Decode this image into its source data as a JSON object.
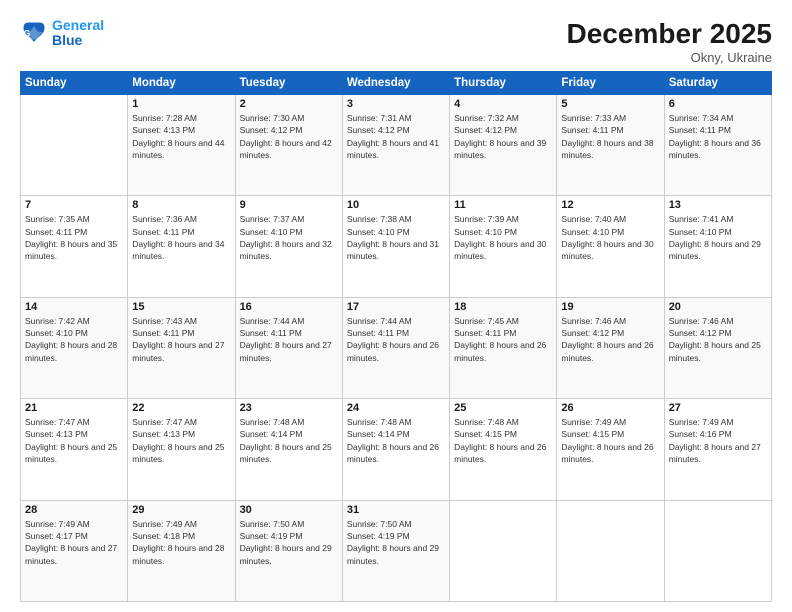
{
  "header": {
    "logo_line1": "General",
    "logo_line2": "Blue",
    "month_title": "December 2025",
    "location": "Okny, Ukraine"
  },
  "days_of_week": [
    "Sunday",
    "Monday",
    "Tuesday",
    "Wednesday",
    "Thursday",
    "Friday",
    "Saturday"
  ],
  "weeks": [
    [
      {
        "day": "",
        "sunrise": "",
        "sunset": "",
        "daylight": ""
      },
      {
        "day": "1",
        "sunrise": "Sunrise: 7:28 AM",
        "sunset": "Sunset: 4:13 PM",
        "daylight": "Daylight: 8 hours and 44 minutes."
      },
      {
        "day": "2",
        "sunrise": "Sunrise: 7:30 AM",
        "sunset": "Sunset: 4:12 PM",
        "daylight": "Daylight: 8 hours and 42 minutes."
      },
      {
        "day": "3",
        "sunrise": "Sunrise: 7:31 AM",
        "sunset": "Sunset: 4:12 PM",
        "daylight": "Daylight: 8 hours and 41 minutes."
      },
      {
        "day": "4",
        "sunrise": "Sunrise: 7:32 AM",
        "sunset": "Sunset: 4:12 PM",
        "daylight": "Daylight: 8 hours and 39 minutes."
      },
      {
        "day": "5",
        "sunrise": "Sunrise: 7:33 AM",
        "sunset": "Sunset: 4:11 PM",
        "daylight": "Daylight: 8 hours and 38 minutes."
      },
      {
        "day": "6",
        "sunrise": "Sunrise: 7:34 AM",
        "sunset": "Sunset: 4:11 PM",
        "daylight": "Daylight: 8 hours and 36 minutes."
      }
    ],
    [
      {
        "day": "7",
        "sunrise": "Sunrise: 7:35 AM",
        "sunset": "Sunset: 4:11 PM",
        "daylight": "Daylight: 8 hours and 35 minutes."
      },
      {
        "day": "8",
        "sunrise": "Sunrise: 7:36 AM",
        "sunset": "Sunset: 4:11 PM",
        "daylight": "Daylight: 8 hours and 34 minutes."
      },
      {
        "day": "9",
        "sunrise": "Sunrise: 7:37 AM",
        "sunset": "Sunset: 4:10 PM",
        "daylight": "Daylight: 8 hours and 32 minutes."
      },
      {
        "day": "10",
        "sunrise": "Sunrise: 7:38 AM",
        "sunset": "Sunset: 4:10 PM",
        "daylight": "Daylight: 8 hours and 31 minutes."
      },
      {
        "day": "11",
        "sunrise": "Sunrise: 7:39 AM",
        "sunset": "Sunset: 4:10 PM",
        "daylight": "Daylight: 8 hours and 30 minutes."
      },
      {
        "day": "12",
        "sunrise": "Sunrise: 7:40 AM",
        "sunset": "Sunset: 4:10 PM",
        "daylight": "Daylight: 8 hours and 30 minutes."
      },
      {
        "day": "13",
        "sunrise": "Sunrise: 7:41 AM",
        "sunset": "Sunset: 4:10 PM",
        "daylight": "Daylight: 8 hours and 29 minutes."
      }
    ],
    [
      {
        "day": "14",
        "sunrise": "Sunrise: 7:42 AM",
        "sunset": "Sunset: 4:10 PM",
        "daylight": "Daylight: 8 hours and 28 minutes."
      },
      {
        "day": "15",
        "sunrise": "Sunrise: 7:43 AM",
        "sunset": "Sunset: 4:11 PM",
        "daylight": "Daylight: 8 hours and 27 minutes."
      },
      {
        "day": "16",
        "sunrise": "Sunrise: 7:44 AM",
        "sunset": "Sunset: 4:11 PM",
        "daylight": "Daylight: 8 hours and 27 minutes."
      },
      {
        "day": "17",
        "sunrise": "Sunrise: 7:44 AM",
        "sunset": "Sunset: 4:11 PM",
        "daylight": "Daylight: 8 hours and 26 minutes."
      },
      {
        "day": "18",
        "sunrise": "Sunrise: 7:45 AM",
        "sunset": "Sunset: 4:11 PM",
        "daylight": "Daylight: 8 hours and 26 minutes."
      },
      {
        "day": "19",
        "sunrise": "Sunrise: 7:46 AM",
        "sunset": "Sunset: 4:12 PM",
        "daylight": "Daylight: 8 hours and 26 minutes."
      },
      {
        "day": "20",
        "sunrise": "Sunrise: 7:46 AM",
        "sunset": "Sunset: 4:12 PM",
        "daylight": "Daylight: 8 hours and 25 minutes."
      }
    ],
    [
      {
        "day": "21",
        "sunrise": "Sunrise: 7:47 AM",
        "sunset": "Sunset: 4:13 PM",
        "daylight": "Daylight: 8 hours and 25 minutes."
      },
      {
        "day": "22",
        "sunrise": "Sunrise: 7:47 AM",
        "sunset": "Sunset: 4:13 PM",
        "daylight": "Daylight: 8 hours and 25 minutes."
      },
      {
        "day": "23",
        "sunrise": "Sunrise: 7:48 AM",
        "sunset": "Sunset: 4:14 PM",
        "daylight": "Daylight: 8 hours and 25 minutes."
      },
      {
        "day": "24",
        "sunrise": "Sunrise: 7:48 AM",
        "sunset": "Sunset: 4:14 PM",
        "daylight": "Daylight: 8 hours and 26 minutes."
      },
      {
        "day": "25",
        "sunrise": "Sunrise: 7:48 AM",
        "sunset": "Sunset: 4:15 PM",
        "daylight": "Daylight: 8 hours and 26 minutes."
      },
      {
        "day": "26",
        "sunrise": "Sunrise: 7:49 AM",
        "sunset": "Sunset: 4:15 PM",
        "daylight": "Daylight: 8 hours and 26 minutes."
      },
      {
        "day": "27",
        "sunrise": "Sunrise: 7:49 AM",
        "sunset": "Sunset: 4:16 PM",
        "daylight": "Daylight: 8 hours and 27 minutes."
      }
    ],
    [
      {
        "day": "28",
        "sunrise": "Sunrise: 7:49 AM",
        "sunset": "Sunset: 4:17 PM",
        "daylight": "Daylight: 8 hours and 27 minutes."
      },
      {
        "day": "29",
        "sunrise": "Sunrise: 7:49 AM",
        "sunset": "Sunset: 4:18 PM",
        "daylight": "Daylight: 8 hours and 28 minutes."
      },
      {
        "day": "30",
        "sunrise": "Sunrise: 7:50 AM",
        "sunset": "Sunset: 4:19 PM",
        "daylight": "Daylight: 8 hours and 29 minutes."
      },
      {
        "day": "31",
        "sunrise": "Sunrise: 7:50 AM",
        "sunset": "Sunset: 4:19 PM",
        "daylight": "Daylight: 8 hours and 29 minutes."
      },
      {
        "day": "",
        "sunrise": "",
        "sunset": "",
        "daylight": ""
      },
      {
        "day": "",
        "sunrise": "",
        "sunset": "",
        "daylight": ""
      },
      {
        "day": "",
        "sunrise": "",
        "sunset": "",
        "daylight": ""
      }
    ]
  ]
}
